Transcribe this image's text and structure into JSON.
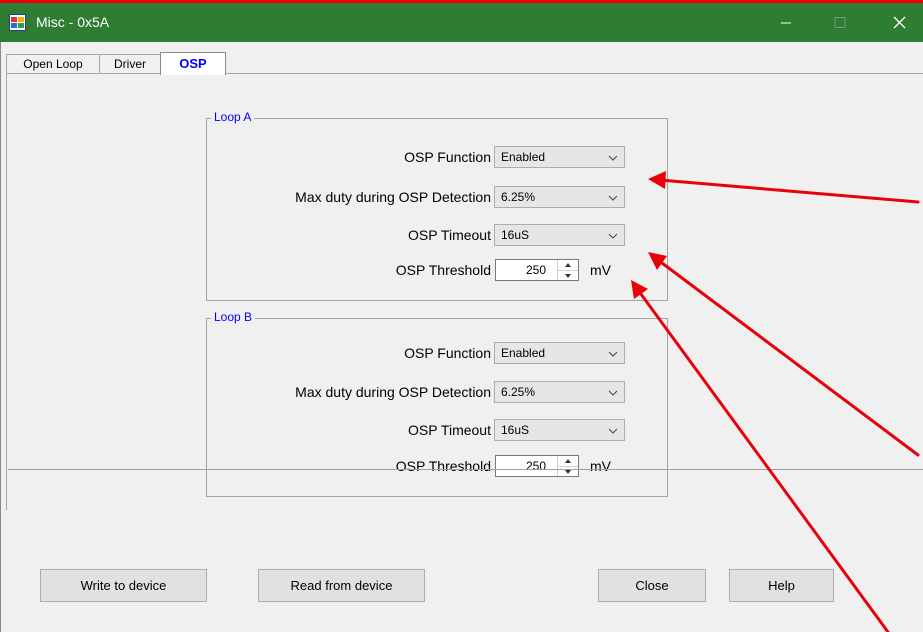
{
  "window": {
    "title": "Misc - 0x5A"
  },
  "tabs": [
    {
      "label": "Open Loop"
    },
    {
      "label": "Driver"
    },
    {
      "label": "OSP",
      "selected": true
    }
  ],
  "loop_a": {
    "legend": "Loop A",
    "osp_function": {
      "label": "OSP Function",
      "value": "Enabled"
    },
    "max_duty": {
      "label": "Max duty during OSP Detection",
      "value": "6.25%"
    },
    "osp_timeout": {
      "label": "OSP Timeout",
      "value": "16uS"
    },
    "osp_threshold": {
      "label": "OSP Threshold",
      "value": "250",
      "unit": "mV"
    }
  },
  "loop_b": {
    "legend": "Loop B",
    "osp_function": {
      "label": "OSP Function",
      "value": "Enabled"
    },
    "max_duty": {
      "label": "Max duty during OSP Detection",
      "value": "6.25%"
    },
    "osp_timeout": {
      "label": "OSP Timeout",
      "value": "16uS"
    },
    "osp_threshold": {
      "label": "OSP Threshold",
      "value": "250",
      "unit": "mV"
    }
  },
  "buttons": {
    "write": "Write to device",
    "read": "Read from device",
    "close": "Close",
    "help": "Help"
  },
  "colors": {
    "titlebar": "#2f7d32",
    "annotation_arrow": "#e8000b",
    "tab_selected_text": "#0000ff",
    "group_legend": "#0000ff"
  },
  "icons": {
    "app": "app-window-icon",
    "minimize": "minimize-icon",
    "maximize": "maximize-icon",
    "close": "close-icon",
    "dropdown": "chevron-down-icon",
    "spin": "spin-up-down-icon"
  }
}
